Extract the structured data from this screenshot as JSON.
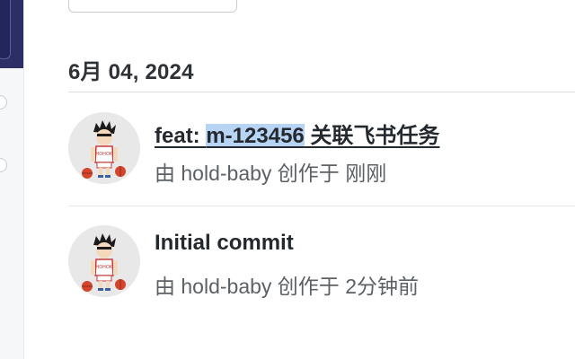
{
  "commit_list": {
    "date_heading": "6月 04, 2024",
    "commits": [
      {
        "title_prefix": "feat: ",
        "title_issue": "m-123456",
        "title_suffix": " 关联飞书任务",
        "meta": "由 hold-baby 创作于 刚刚"
      },
      {
        "title": "Initial commit",
        "meta": "由 hold-baby 创作于 2分钟前"
      }
    ]
  },
  "colors": {
    "nav_accent": "#2b2f66",
    "highlight": "#b7d4f5"
  },
  "icons": {
    "avatar": "cartoon-basketball-player-avatar"
  }
}
